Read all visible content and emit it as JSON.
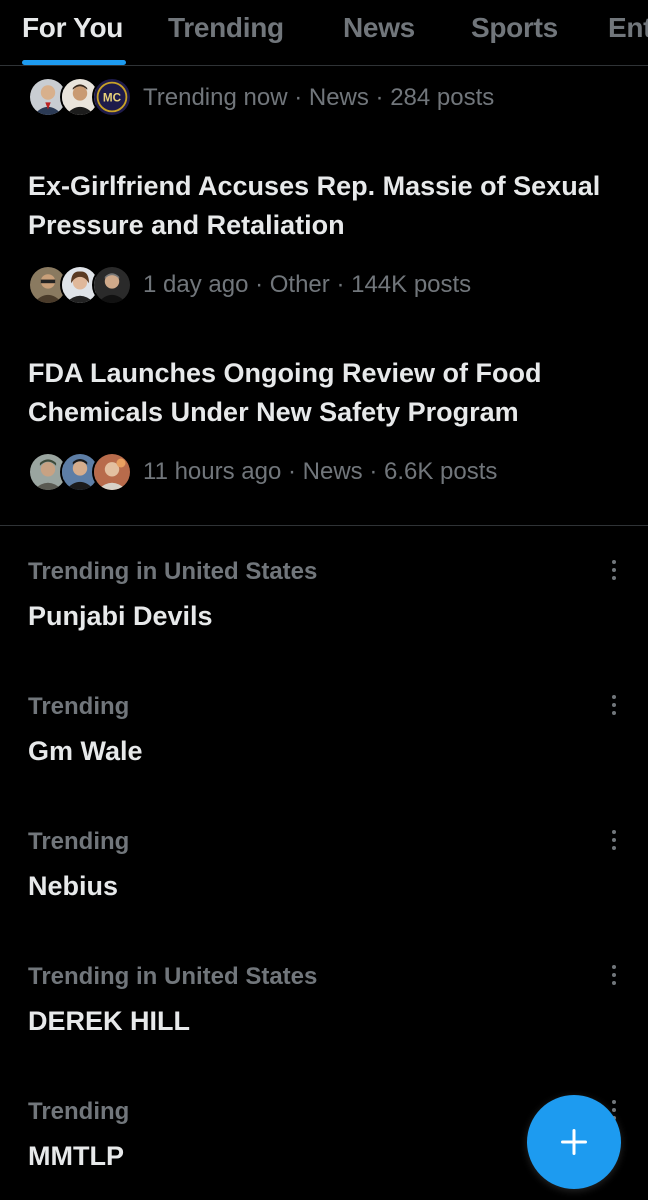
{
  "tabs": [
    {
      "label": "For You",
      "active": true
    },
    {
      "label": "Trending",
      "active": false
    },
    {
      "label": "News",
      "active": false
    },
    {
      "label": "Sports",
      "active": false
    },
    {
      "label": "Ent",
      "active": false
    }
  ],
  "news": [
    {
      "meta": "Trending now · News · 284 posts"
    },
    {
      "headline": "Ex-Girlfriend Accuses Rep. Massie of Sexual Pressure and Retaliation",
      "meta": "1 day ago · Other · 144K posts"
    },
    {
      "headline": "FDA Launches Ongoing Review of Food Chemicals Under New Safety Program",
      "meta": "11 hours ago · News · 6.6K posts"
    }
  ],
  "avatar_badge": "MC",
  "trends": [
    {
      "context": "Trending in United States",
      "name": "Punjabi Devils"
    },
    {
      "context": "Trending",
      "name": "Gm Wale"
    },
    {
      "context": "Trending",
      "name": "Nebius"
    },
    {
      "context": "Trending in United States",
      "name": "DEREK HILL"
    },
    {
      "context": "Trending",
      "name": "MMTLP"
    }
  ],
  "colors": {
    "accent": "#1d9bf0",
    "background": "#000000",
    "muted": "#71767b",
    "text": "#e7e9ea"
  },
  "icons": {
    "more": "more-vertical-icon",
    "compose": "plus-icon"
  }
}
